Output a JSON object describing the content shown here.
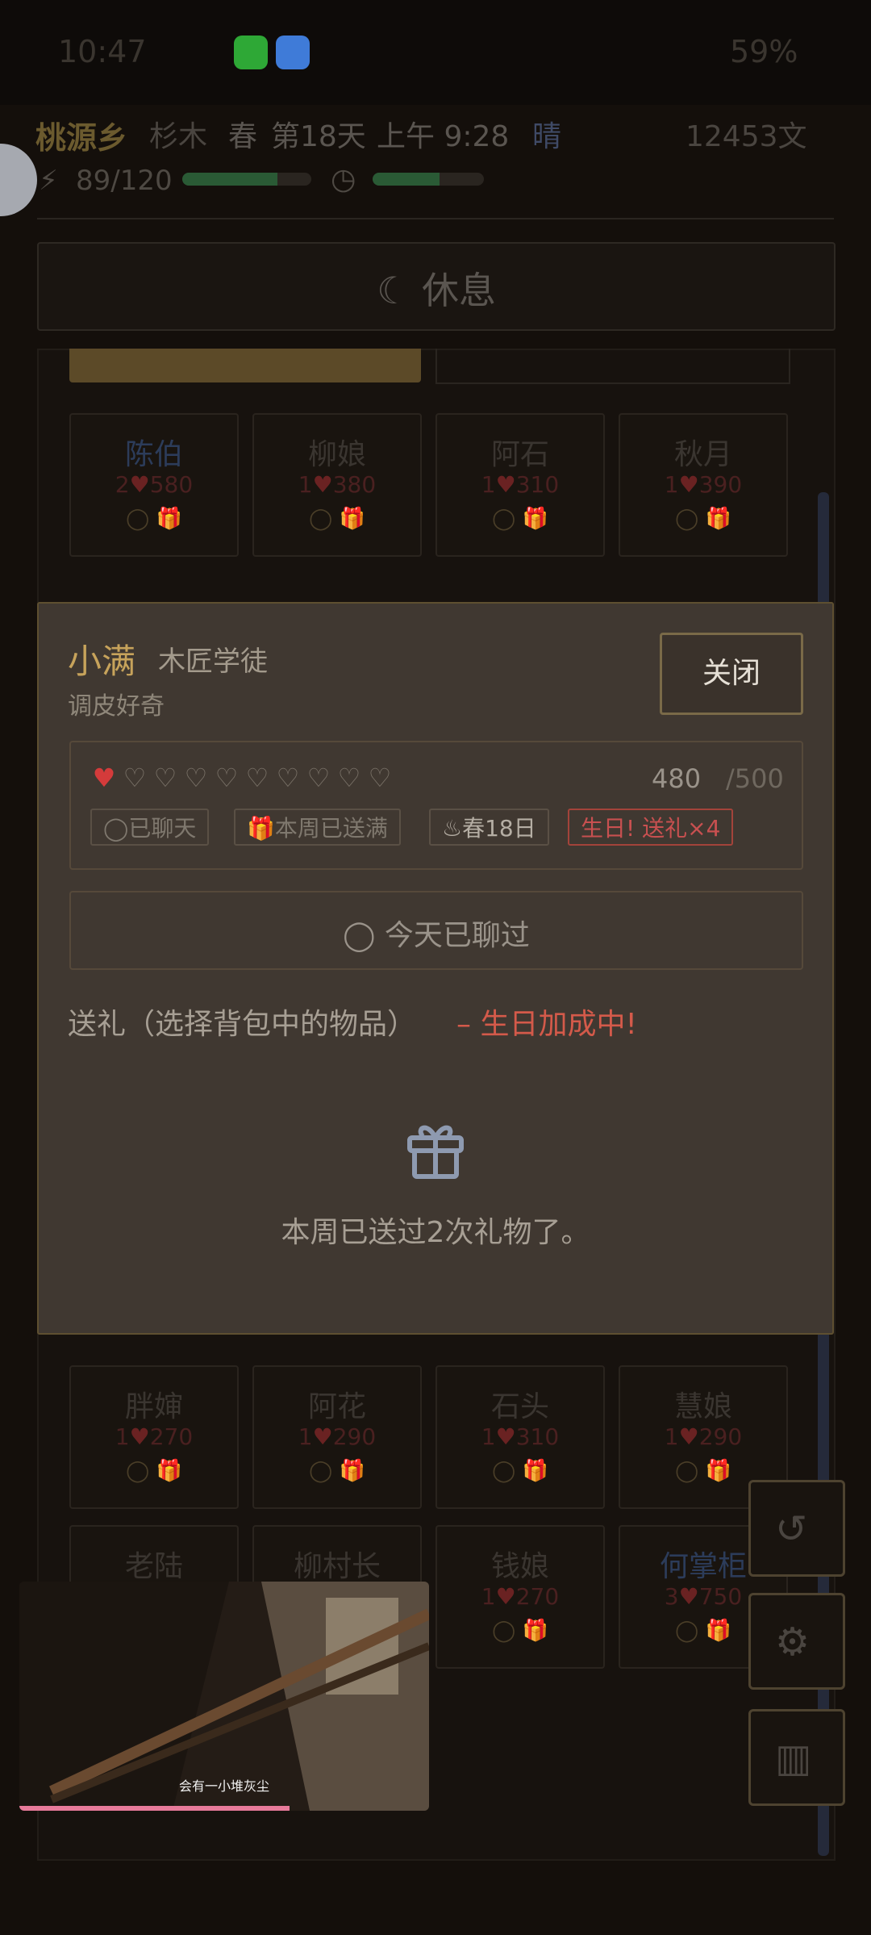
{
  "status_bar": {
    "time": "10:47",
    "battery_pct": "59%"
  },
  "header": {
    "town": "桃源乡",
    "tree": "杉木",
    "season": "春",
    "day": "第18天",
    "time": "上午 9:28",
    "weather": "晴",
    "money": "12453文",
    "energy": "89/120",
    "energy_level": 0.74,
    "time_level": 0.6
  },
  "rest_button": "休息",
  "villagers_row1": [
    {
      "name": "陈伯",
      "level": "2",
      "points": "580",
      "color": "blue"
    },
    {
      "name": "柳娘",
      "level": "1",
      "points": "380"
    },
    {
      "name": "阿石",
      "level": "1",
      "points": "310"
    },
    {
      "name": "秋月",
      "level": "1",
      "points": "390"
    }
  ],
  "villagers_row_b": [
    {
      "name": "胖婶",
      "level": "1",
      "points": "270"
    },
    {
      "name": "阿花",
      "level": "1",
      "points": "290"
    },
    {
      "name": "石头",
      "level": "1",
      "points": "310"
    },
    {
      "name": "慧娘",
      "level": "1",
      "points": "290"
    }
  ],
  "villagers_row_c": [
    {
      "name": "老陆",
      "level": "",
      "points": ""
    },
    {
      "name": "柳村长",
      "level": "",
      "points": ""
    },
    {
      "name": "钱娘",
      "level": "1",
      "points": "270"
    },
    {
      "name": "何掌柜",
      "level": "3",
      "points": "750",
      "color": "blue"
    }
  ],
  "dialog": {
    "name": "小满",
    "role": "木匠学徒",
    "trait": "调皮好奇",
    "close_label": "关闭",
    "hearts_total": 10,
    "hearts_filled": 1,
    "affection": "480",
    "affection_max": "/500",
    "tags": {
      "chatted": "已聊天",
      "gift_week": "本周已送满",
      "birthday": "春18日",
      "birthday_bonus": "生日! 送礼×4"
    },
    "chat_button": "今天已聊过",
    "gift_title": "送礼（选择背包中的物品）",
    "gift_bonus": "– 生日加成中!",
    "gift_message": "本周已送过2次礼物了。"
  },
  "video": {
    "caption": "会有一小堆灰尘",
    "progress": 0.66
  }
}
